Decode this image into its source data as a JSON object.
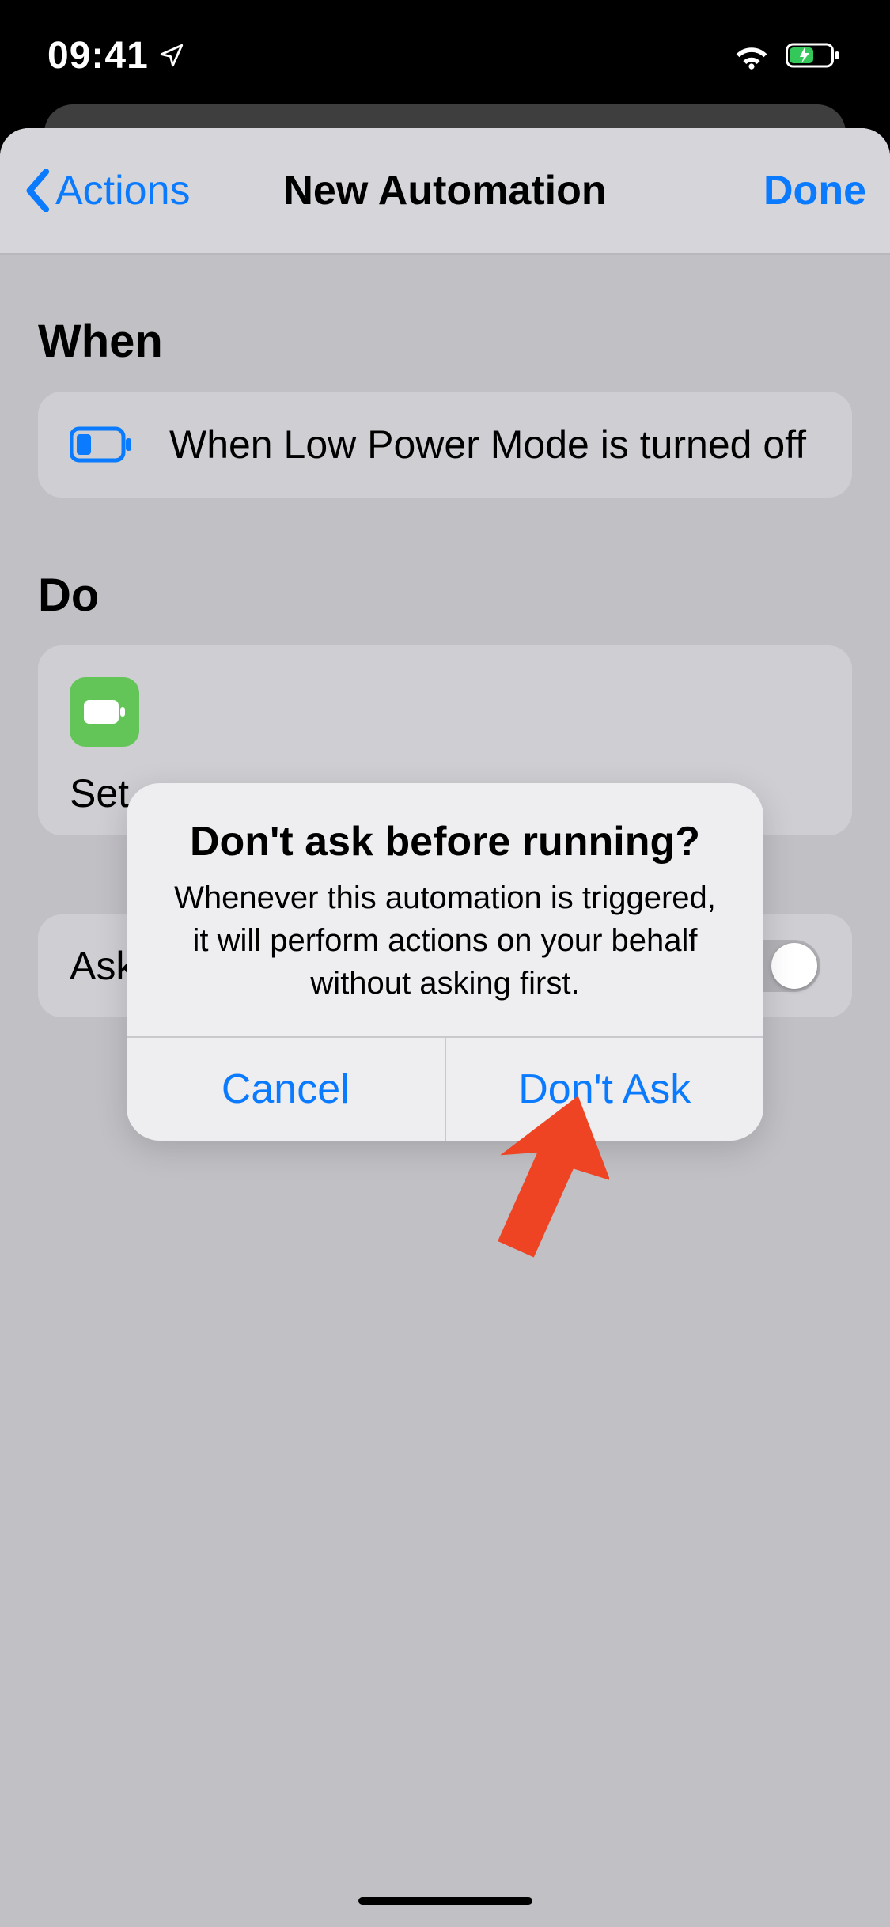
{
  "status": {
    "time": "09:41"
  },
  "nav": {
    "back_label": "Actions",
    "title": "New Automation",
    "done_label": "Done"
  },
  "sections": {
    "when_label": "When",
    "when_condition": "When Low Power Mode is turned off",
    "do_label": "Do",
    "do_action": "Set",
    "ask_label": "Ask"
  },
  "alert": {
    "title": "Don't ask before running?",
    "message": "Whenever this automation is triggered, it will perform actions on your behalf without asking first.",
    "cancel": "Cancel",
    "confirm": "Don't Ask"
  },
  "colors": {
    "tint": "#0a7aff",
    "action_green": "#63c558",
    "arrow": "#ee4423"
  }
}
